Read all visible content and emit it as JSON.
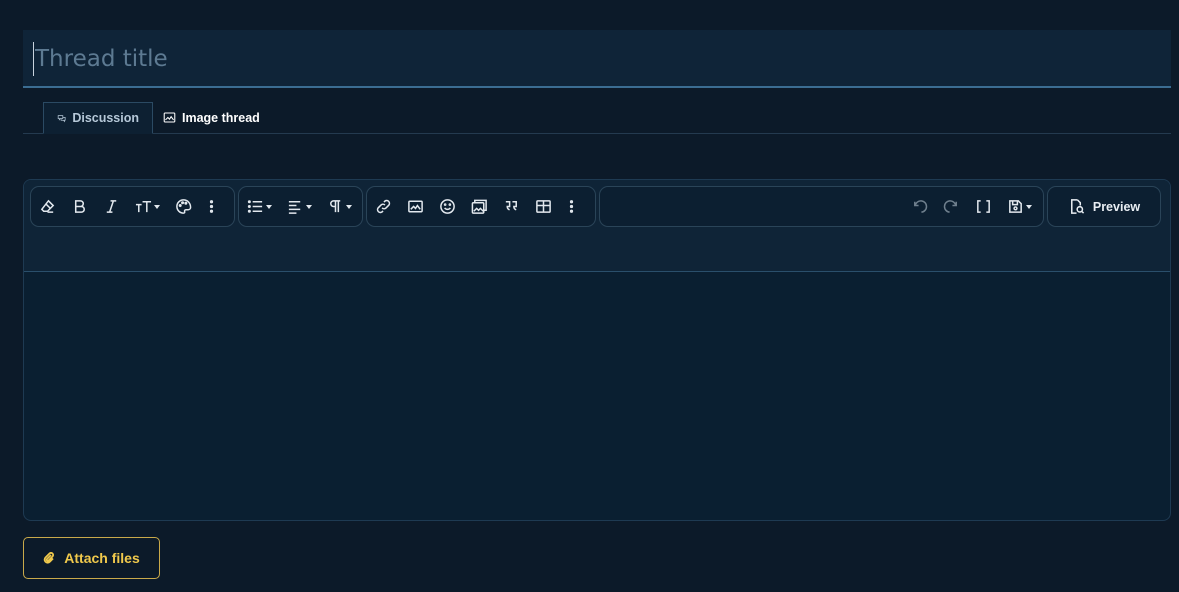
{
  "title_input": {
    "placeholder": "Thread title",
    "value": ""
  },
  "tabs": [
    {
      "label": "Discussion",
      "icon": "chat-bubbles-icon",
      "active": true
    },
    {
      "label": "Image thread",
      "icon": "image-icon",
      "active": false
    }
  ],
  "toolbar": {
    "groups": [
      [
        "clear-format-icon",
        "bold-icon",
        "italic-icon",
        "text-size-icon",
        "palette-icon",
        "more-vertical-icon"
      ],
      [
        "list-icon",
        "align-left-icon",
        "paragraph-icon"
      ],
      [
        "link-icon",
        "image-icon",
        "smile-icon",
        "media-icon",
        "quote-icon",
        "table-icon",
        "more-vertical-icon"
      ],
      [
        "undo-icon",
        "redo-icon",
        "brackets-icon",
        "save-draft-icon"
      ]
    ],
    "preview_label": "Preview"
  },
  "attach": {
    "label": "Attach files",
    "icon": "paperclip-icon"
  },
  "colors": {
    "accent": "#f0c94c",
    "background": "#0c1a29",
    "editor": "#0a1f31"
  }
}
